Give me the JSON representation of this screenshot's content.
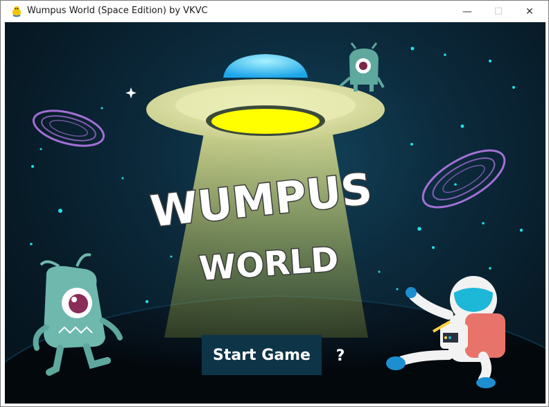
{
  "window": {
    "title": "Wumpus World (Space Edition) by VKVC",
    "minimize_glyph": "—",
    "maximize_glyph": "☐",
    "close_glyph": "✕"
  },
  "game": {
    "title_line1": "WUMPUS",
    "title_line2": "WORLD",
    "start_button": "Start Game",
    "help_button": "?"
  },
  "colors": {
    "sky_center": "#12425a",
    "sky_edge": "#04111a",
    "planet": "#050a10",
    "button_bg": "#0e3447",
    "ufo_light": "#ffff00",
    "beam": "#f4f48a",
    "alien": "#6fb8ae",
    "swirl": "#b478e8",
    "star": "#22e0e8"
  },
  "icons": {
    "app_icon": "pygame-snake-icon",
    "minimize": "minimize-icon",
    "maximize": "maximize-icon",
    "close": "close-icon"
  }
}
